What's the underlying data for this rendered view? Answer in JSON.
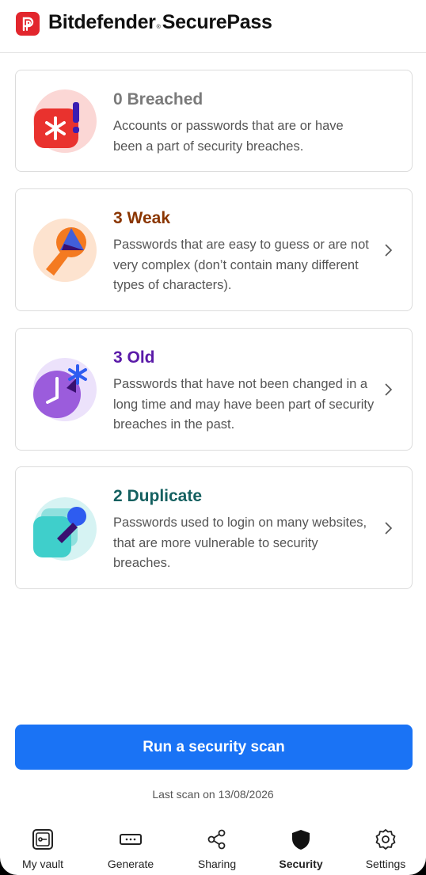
{
  "app": {
    "brand_name": "Bitdefender",
    "brand_tm": "®",
    "product_name": "SecurePass"
  },
  "cards": [
    {
      "title": "0 Breached",
      "description": "Accounts or passwords that are or have been a part of security breaches.",
      "color": "#7a7a7a",
      "icon": "breached-icon"
    },
    {
      "title": "3 Weak",
      "description": "Passwords that are easy to guess or are not very complex (don’t contain many different types of characters).",
      "color": "#8a3500",
      "icon": "weak-key-icon"
    },
    {
      "title": "3 Old",
      "description": "Passwords that have not been changed in a long time and may have been part of security breaches in the past.",
      "color": "#5a1aa8",
      "icon": "old-clock-icon"
    },
    {
      "title": "2 Duplicate",
      "description": "Passwords used to login on many websites, that are more vulnerable to security breaches.",
      "color": "#146060",
      "icon": "duplicate-cards-icon"
    }
  ],
  "scan": {
    "button_label": "Run a security scan",
    "last_scan": "Last scan on 13/08/2026"
  },
  "nav": {
    "items": [
      {
        "label": "My vault",
        "icon": "vault-icon"
      },
      {
        "label": "Generate",
        "icon": "generate-icon"
      },
      {
        "label": "Sharing",
        "icon": "share-icon"
      },
      {
        "label": "Security",
        "icon": "shield-icon",
        "active": true
      },
      {
        "label": "Settings",
        "icon": "gear-icon"
      }
    ]
  },
  "colors": {
    "accent": "#1a73f5",
    "brand_red": "#e2262d"
  }
}
